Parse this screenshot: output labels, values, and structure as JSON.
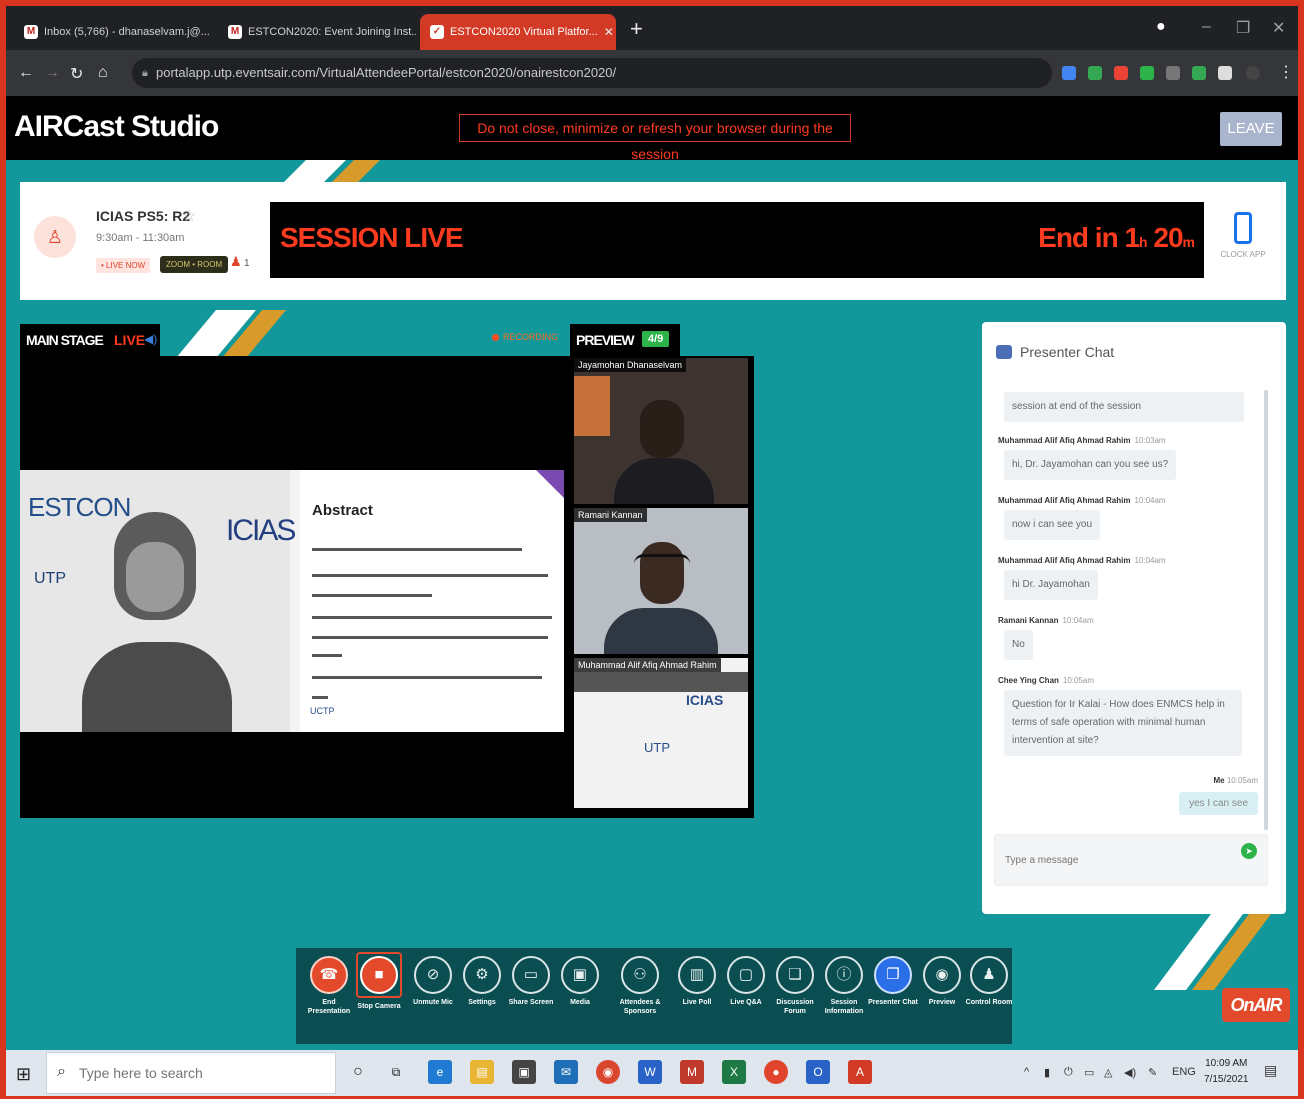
{
  "browser": {
    "tabs": [
      {
        "label": "Inbox (5,766) - dhanaselvam.j@...",
        "icon": "gmail-icon"
      },
      {
        "label": "ESTCON2020: Event Joining Inst...",
        "icon": "gmail-icon"
      },
      {
        "label": "ESTCON2020 Virtual Platfor...",
        "icon": "eventsair-icon"
      }
    ],
    "url": "portalapp.utp.eventsair.com/VirtualAttendeePortal/estcon2020/onairestcon2020/"
  },
  "header": {
    "app_title": "AIRCast Studio",
    "warning": "Do not close, minimize or refresh your browser during the session",
    "leave_label": "LEAVE"
  },
  "session": {
    "name": "ICIAS PS5: R2",
    "time": "9:30am - 11:30am",
    "live_badge": "• LIVE NOW",
    "dark_badge": "ZOOM • ROOM",
    "attendee_count": "1",
    "live_text": "SESSION LIVE",
    "end_prefix": "End in",
    "end_hours": "1",
    "end_hours_unit": "h",
    "end_minutes": "20",
    "end_minutes_unit": "m",
    "clock_app_label": "CLOCK APP"
  },
  "main_stage": {
    "title": "MAIN STAGE",
    "live": "LIVE",
    "recording": "RECORDING",
    "slide_title_left": "ESTCON",
    "slide_logo": "ICIAS",
    "slide_utp": "UTP",
    "slide_abstract": "Abstract",
    "slide_footer": "UCTP"
  },
  "preview": {
    "title": "PREVIEW",
    "count": "4/9",
    "participants": [
      {
        "name": "Jayamohan Dhanaselvam"
      },
      {
        "name": "Ramani Kannan"
      },
      {
        "name": "Muhammad Alif Afiq Ahmad Rahim"
      }
    ]
  },
  "chat": {
    "title": "Presenter Chat",
    "messages": [
      {
        "author": "",
        "time": "",
        "text": "session at end of the session"
      },
      {
        "author": "Muhammad Alif Afiq Ahmad Rahim",
        "time": "10:03am",
        "text": "hi, Dr. Jayamohan can you see us?"
      },
      {
        "author": "Muhammad Alif Afiq Ahmad Rahim",
        "time": "10:04am",
        "text": "now i can see you"
      },
      {
        "author": "Muhammad Alif Afiq Ahmad Rahim",
        "time": "10:04am",
        "text": "hi Dr. Jayamohan"
      },
      {
        "author": "Ramani Kannan",
        "time": "10:04am",
        "text": "No"
      },
      {
        "author": "Chee Ying Chan",
        "time": "10:05am",
        "text": "Question for Ir Kalai - How does ENMCS help in terms of safe operation with minimal human intervention at site?"
      }
    ],
    "my_message": {
      "author": "Me",
      "time": "10:05am",
      "text": "yes I can see"
    },
    "input_placeholder": "Type a message"
  },
  "toolbar": [
    {
      "label": "End Presentation",
      "icon": "phone-hangup-icon",
      "symbol": "☎"
    },
    {
      "label": "Stop Camera",
      "icon": "camera-icon",
      "symbol": "■"
    },
    {
      "label": "Unmute Mic",
      "icon": "mic-muted-icon",
      "symbol": "⊘"
    },
    {
      "label": "Settings",
      "icon": "gear-icon",
      "symbol": "⚙"
    },
    {
      "label": "Share Screen",
      "icon": "screen-share-icon",
      "symbol": "▭"
    },
    {
      "label": "Media",
      "icon": "media-icon",
      "symbol": "▣"
    },
    {
      "label": "Attendees & Sponsors",
      "icon": "people-icon",
      "symbol": "⚇"
    },
    {
      "label": "Live Poll",
      "icon": "poll-icon",
      "symbol": "▥"
    },
    {
      "label": "Live Q&A",
      "icon": "qa-icon",
      "symbol": "▢"
    },
    {
      "label": "Discussion Forum",
      "icon": "forum-icon",
      "symbol": "❏"
    },
    {
      "label": "Session Information",
      "icon": "info-icon",
      "symbol": "ⓘ"
    },
    {
      "label": "Presenter Chat",
      "icon": "chat-icon",
      "symbol": "❐"
    },
    {
      "label": "Preview",
      "icon": "eye-icon",
      "symbol": "◉"
    },
    {
      "label": "Control Room",
      "icon": "user-icon",
      "symbol": "♟"
    }
  ],
  "onair_label": "OnAIR",
  "taskbar": {
    "search_placeholder": "Type here to search",
    "language": "ENG",
    "time": "10:09 AM",
    "date": "7/15/2021"
  }
}
